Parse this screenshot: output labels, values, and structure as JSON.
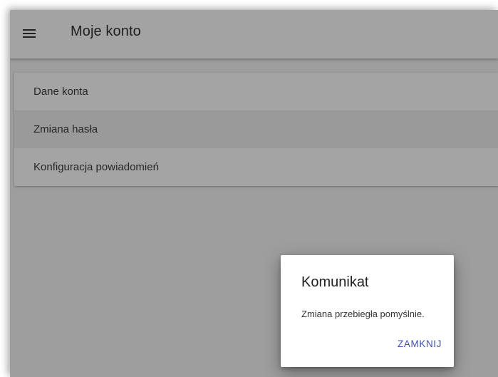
{
  "header": {
    "menu_icon": "hamburger-menu-icon",
    "title": "Moje konto"
  },
  "menu": {
    "items": [
      {
        "label": "Dane konta",
        "active": false
      },
      {
        "label": "Zmiana hasła",
        "active": true
      },
      {
        "label": "Konfiguracja powiadomień",
        "active": false
      }
    ]
  },
  "dialog": {
    "title": "Komunikat",
    "message": "Zmiana przebiegła pomyślnie.",
    "close_label": "ZAMKNIJ"
  },
  "colors": {
    "backdrop": "#9e9e9e",
    "appbar": "#a3a3a3",
    "dialog_background": "#ffffff",
    "accent": "#3f51b5"
  }
}
